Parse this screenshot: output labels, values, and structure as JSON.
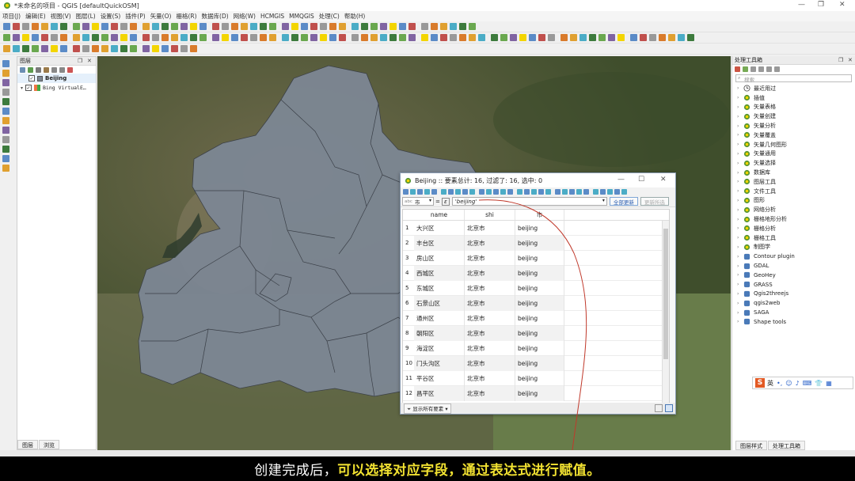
{
  "window": {
    "title": "*未命名的项目 - QGIS [defaultQuickOSM]",
    "controls": [
      "—",
      "❐",
      "✕"
    ]
  },
  "menu": [
    "项目(J)",
    "编辑(E)",
    "视图(V)",
    "图层(L)",
    "设置(S)",
    "插件(P)",
    "矢量(O)",
    "栅格(R)",
    "数据库(D)",
    "网络(W)",
    "HCMGIS",
    "MMQGIS",
    "处理(C)",
    "帮助(H)"
  ],
  "layers_panel": {
    "title": "图层",
    "layers": [
      {
        "name": "Beijing",
        "checked": true
      },
      {
        "name": "Bing VirtualE…",
        "checked": true
      }
    ],
    "bottom_tabs": [
      "图层",
      "浏览"
    ]
  },
  "processing_panel": {
    "title": "处理工具箱",
    "search_placeholder": "搜索",
    "items": [
      "最近用过",
      "插值",
      "矢量表格",
      "矢量创建",
      "矢量分析",
      "矢量覆盖",
      "矢量几何图形",
      "矢量通用",
      "矢量选择",
      "数据库",
      "图层工具",
      "文件工具",
      "图形",
      "网络分析",
      "栅格地形分析",
      "栅格分析",
      "栅格工具",
      "制图学",
      "Contour plugin",
      "GDAL",
      "GeoHey",
      "GRASS",
      "Qgis2threejs",
      "qgis2web",
      "SAGA",
      "Shape tools"
    ],
    "bottom_tabs": [
      "图层样式",
      "处理工具箱"
    ]
  },
  "attribute_dialog": {
    "title": "Beijing :: 要素总计: 16, 过滤了: 16, 选中: 0",
    "field_selector": {
      "prefix": "abc",
      "value": "市"
    },
    "expression": "'beijing'",
    "update_all_label": "全部更新",
    "update_selected_label": "更新所选",
    "columns": [
      "name",
      "shi",
      "市"
    ],
    "rows": [
      [
        "1",
        "大兴区",
        "北京市",
        "beijing"
      ],
      [
        "2",
        "丰台区",
        "北京市",
        "beijing"
      ],
      [
        "3",
        "房山区",
        "北京市",
        "beijing"
      ],
      [
        "4",
        "西城区",
        "北京市",
        "beijing"
      ],
      [
        "5",
        "东城区",
        "北京市",
        "beijing"
      ],
      [
        "6",
        "石景山区",
        "北京市",
        "beijing"
      ],
      [
        "7",
        "通州区",
        "北京市",
        "beijing"
      ],
      [
        "8",
        "朝阳区",
        "北京市",
        "beijing"
      ],
      [
        "9",
        "海淀区",
        "北京市",
        "beijing"
      ],
      [
        "10",
        "门头沟区",
        "北京市",
        "beijing"
      ],
      [
        "11",
        "平谷区",
        "北京市",
        "beijing"
      ],
      [
        "12",
        "昌平区",
        "北京市",
        "beijing"
      ]
    ],
    "filter_label": "显示所有要素"
  },
  "ime": {
    "label": "英"
  },
  "subtitle": {
    "part1": "创建完成后，",
    "part2": "可以选择对应字段，通过表达式进行赋值。"
  },
  "colors": {
    "map_polygon": "#7d8794",
    "annotation": "#c0392b",
    "subtitle_highlight": "#f2e231"
  }
}
